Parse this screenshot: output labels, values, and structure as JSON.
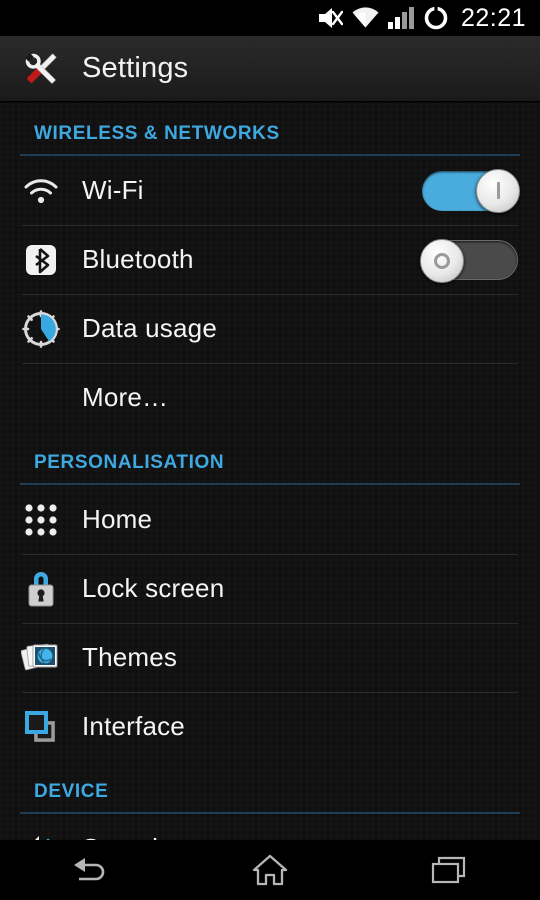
{
  "status_bar": {
    "icons": [
      {
        "name": "vibrate-mute-icon",
        "label": "vibrate"
      },
      {
        "name": "wifi-signal-icon",
        "label": "wifi"
      },
      {
        "name": "cellular-signal-icon",
        "label": "signal"
      },
      {
        "name": "battery-ring-icon",
        "label": "battery"
      }
    ],
    "clock": "22:21"
  },
  "action_bar": {
    "icon": "settings-tools-icon",
    "title": "Settings"
  },
  "sections": [
    {
      "header": "WIRELESS & NETWORKS",
      "rows": [
        {
          "label": "Wi-Fi",
          "icon": "wifi-icon",
          "control": "switch",
          "state": "on",
          "state_mark": "I"
        },
        {
          "label": "Bluetooth",
          "icon": "bluetooth-icon",
          "control": "switch",
          "state": "off",
          "state_mark": "O"
        },
        {
          "label": "Data usage",
          "icon": "data-usage-icon",
          "control": "none"
        },
        {
          "label": "More…",
          "icon": "none",
          "control": "none"
        }
      ]
    },
    {
      "header": "PERSONALISATION",
      "rows": [
        {
          "label": "Home",
          "icon": "app-grid-icon",
          "control": "none"
        },
        {
          "label": "Lock screen",
          "icon": "padlock-icon",
          "control": "none"
        },
        {
          "label": "Themes",
          "icon": "themes-icon",
          "control": "none"
        },
        {
          "label": "Interface",
          "icon": "interface-icon",
          "control": "none"
        }
      ]
    },
    {
      "header": "DEVICE",
      "rows": [
        {
          "label": "Sound",
          "icon": "speaker-icon",
          "control": "none"
        }
      ]
    }
  ],
  "nav_bar": {
    "buttons": [
      {
        "name": "back-button",
        "icon": "back-arrow-icon"
      },
      {
        "name": "home-button",
        "icon": "home-icon"
      },
      {
        "name": "recents-button",
        "icon": "recents-icon"
      }
    ]
  },
  "colors": {
    "accent_blue": "#3ea8e0",
    "section_rule": "#1f3d55",
    "switch_on": "#4aabdd",
    "switch_off": "#4a4a4a",
    "background": "#121212",
    "text_primary": "#f4f4f4"
  }
}
